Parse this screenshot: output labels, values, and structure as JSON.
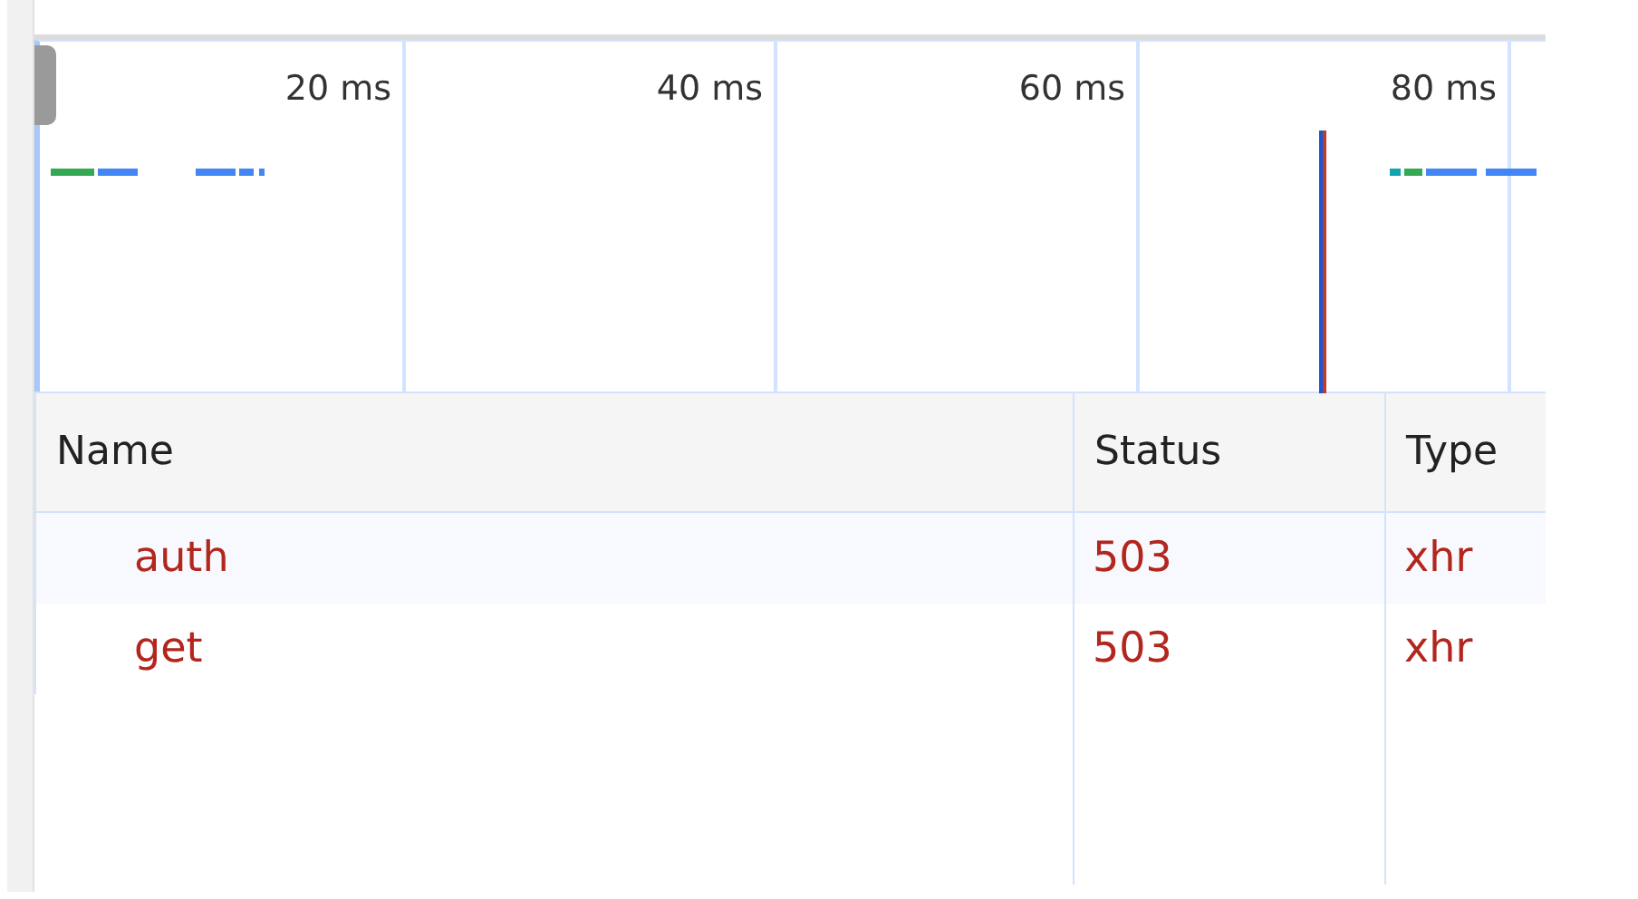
{
  "overview": {
    "tick_labels": [
      "20 ms",
      "40 ms",
      "60 ms",
      "80 ms"
    ]
  },
  "table": {
    "columns": [
      "Name",
      "Status",
      "Type"
    ],
    "rows": [
      {
        "name": "auth",
        "status": "503",
        "type": "xhr",
        "failed": true
      },
      {
        "name": "get",
        "status": "503",
        "type": "xhr",
        "failed": true
      }
    ]
  }
}
